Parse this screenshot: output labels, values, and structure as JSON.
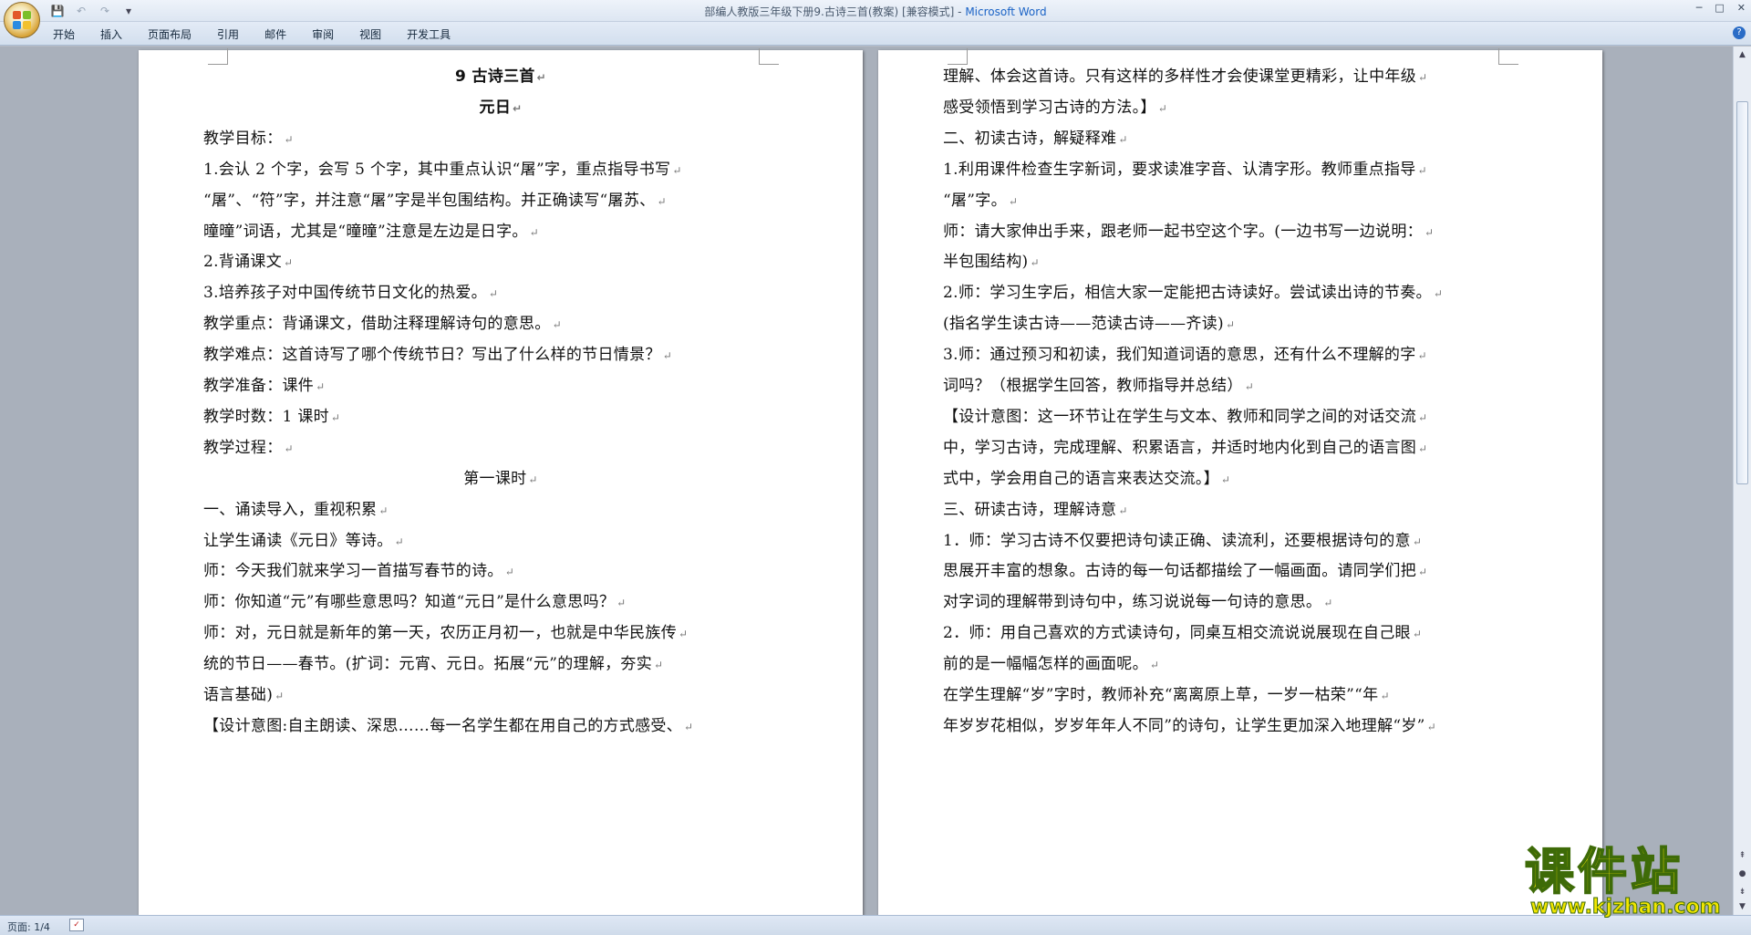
{
  "window": {
    "title_doc": "部编人教版三年级下册9.古诗三首(教案) [兼容模式] - ",
    "title_app": "Microsoft Word",
    "minimize": "─",
    "maximize": "□",
    "close": "✕"
  },
  "qat": {
    "save": "💾",
    "undo": "↶",
    "redo": "↷",
    "customize": "▾"
  },
  "ribbon": {
    "tabs": [
      "开始",
      "插入",
      "页面布局",
      "引用",
      "邮件",
      "审阅",
      "视图",
      "开发工具"
    ],
    "help": "?"
  },
  "page1": {
    "lines": [
      {
        "t": "9 古诗三首",
        "center": true,
        "bold": true
      },
      {
        "t": "元日",
        "center": true,
        "bold": true
      },
      {
        "t": "教学目标："
      },
      {
        "t": "1.会认 2 个字，会写 5 个字，其中重点认识“屠”字，重点指导书写"
      },
      {
        "t": "“屠”、“符”字，并注意“屠”字是半包围结构。并正确读写“屠苏、"
      },
      {
        "t": "曈曈”词语，尤其是“曈曈”注意是左边是日字。"
      },
      {
        "t": "2.背诵课文"
      },
      {
        "t": "3.培养孩子对中国传统节日文化的热爱。"
      },
      {
        "t": "教学重点：背诵课文，借助注释理解诗句的意思。"
      },
      {
        "t": "教学难点：这首诗写了哪个传统节日？写出了什么样的节日情景？"
      },
      {
        "t": "教学准备：课件"
      },
      {
        "t": "教学时数：1 课时"
      },
      {
        "t": "教学过程："
      },
      {
        "t": "第一课时",
        "center": true
      },
      {
        "t": "一、诵读导入，重视积累"
      },
      {
        "t": "让学生诵读《元日》等诗。"
      },
      {
        "t": "师：今天我们就来学习一首描写春节的诗。"
      },
      {
        "t": "师：你知道“元”有哪些意思吗？知道“元日”是什么意思吗？"
      },
      {
        "t": "师：对，元日就是新年的第一天，农历正月初一，也就是中华民族传"
      },
      {
        "t": "统的节日——春节。(扩词：元宵、元日。拓展“元”的理解，夯实"
      },
      {
        "t": "语言基础)"
      },
      {
        "t": "【设计意图:自主朗读、深思……每一名学生都在用自己的方式感受、"
      }
    ]
  },
  "page2": {
    "lines": [
      {
        "t": "理解、体会这首诗。只有这样的多样性才会使课堂更精彩，让中年级"
      },
      {
        "t": "感受领悟到学习古诗的方法。】"
      },
      {
        "t": "二、初读古诗，解疑释难"
      },
      {
        "t": "1.利用课件检查生字新词，要求读准字音、认清字形。教师重点指导"
      },
      {
        "t": "“屠”字。"
      },
      {
        "t": "师：请大家伸出手来，跟老师一起书空这个字。(一边书写一边说明："
      },
      {
        "t": "半包围结构)"
      },
      {
        "t": "2.师：学习生字后，相信大家一定能把古诗读好。尝试读出诗的节奏。"
      },
      {
        "t": "(指名学生读古诗——范读古诗——齐读)"
      },
      {
        "t": "3.师：通过预习和初读，我们知道词语的意思，还有什么不理解的字"
      },
      {
        "t": "词吗？（根据学生回答，教师指导并总结）"
      },
      {
        "t": "【设计意图：这一环节让在学生与文本、教师和同学之间的对话交流"
      },
      {
        "t": "中，学习古诗，完成理解、积累语言，并适时地内化到自己的语言图"
      },
      {
        "t": "式中，学会用自己的语言来表达交流。】"
      },
      {
        "t": "三、研读古诗，理解诗意"
      },
      {
        "t": "1．师：学习古诗不仅要把诗句读正确、读流利，还要根据诗句的意"
      },
      {
        "t": "思展开丰富的想象。古诗的每一句话都描绘了一幅画面。请同学们把"
      },
      {
        "t": "对字词的理解带到诗句中，练习说说每一句诗的意思。"
      },
      {
        "t": "2．师：用自己喜欢的方式读诗句，同桌互相交流说说展现在自己眼"
      },
      {
        "t": "前的是一幅幅怎样的画面呢。"
      },
      {
        "t": "在学生理解“岁”字时，教师补充“离离原上草，一岁一枯荣”“年"
      },
      {
        "t": "年岁岁花相似，岁岁年年人不同”的诗句，让学生更加深入地理解“岁”"
      }
    ]
  },
  "paragraph_mark": "↵",
  "statusbar": {
    "page": "页面: 1/4",
    "proof": "✓"
  },
  "watermark": {
    "title": "课件站",
    "url": "www.kjzhan.com"
  },
  "colors": {
    "ribbon": "#dfe8f5",
    "workspace": "#a9b0bb",
    "watermark": "#f2e600"
  }
}
